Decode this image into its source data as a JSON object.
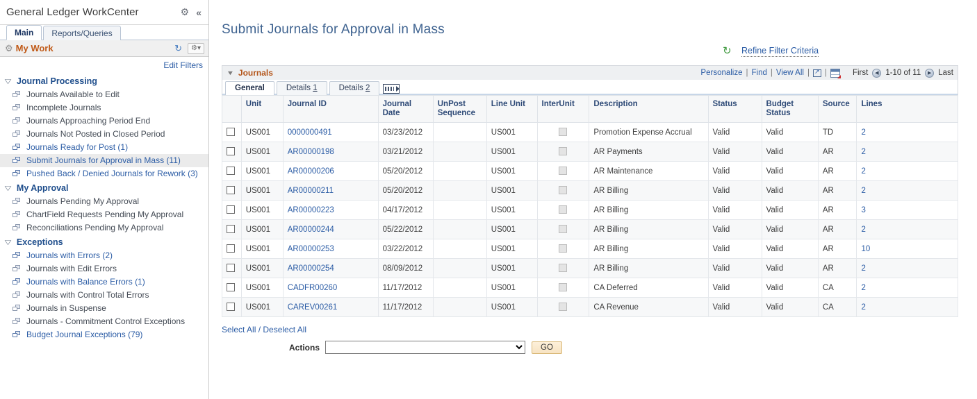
{
  "sidebar": {
    "title": "General Ledger WorkCenter",
    "gear_icon": "gear-icon",
    "collapse_icon": "collapse-icon",
    "tabs": [
      {
        "label": "Main",
        "active": true
      },
      {
        "label": "Reports/Queries",
        "active": false
      }
    ],
    "mywork": {
      "title": "My Work",
      "refresh_icon": "refresh-icon",
      "options_icon": "gear-dropdown-icon"
    },
    "edit_filters": "Edit Filters",
    "groups": [
      {
        "title": "Journal Processing",
        "items": [
          {
            "label": "Journals Available to Edit",
            "link": false,
            "selected": false
          },
          {
            "label": "Incomplete Journals",
            "link": false,
            "selected": false
          },
          {
            "label": "Journals Approaching Period End",
            "link": false,
            "selected": false
          },
          {
            "label": "Journals Not Posted in Closed Period",
            "link": false,
            "selected": false
          },
          {
            "label": "Journals Ready for Post (1)",
            "link": true,
            "selected": false
          },
          {
            "label": "Submit Journals for Approval in Mass (11)",
            "link": true,
            "selected": true
          },
          {
            "label": "Pushed Back / Denied Journals for Rework (3)",
            "link": true,
            "selected": false
          }
        ]
      },
      {
        "title": "My Approval",
        "items": [
          {
            "label": "Journals Pending My Approval",
            "link": false,
            "selected": false
          },
          {
            "label": "ChartField Requests Pending My Approval",
            "link": false,
            "selected": false
          },
          {
            "label": "Reconciliations Pending My Approval",
            "link": false,
            "selected": false
          }
        ]
      },
      {
        "title": "Exceptions",
        "items": [
          {
            "label": "Journals with Errors (2)",
            "link": true,
            "selected": false
          },
          {
            "label": "Journals with Edit Errors",
            "link": false,
            "selected": false
          },
          {
            "label": "Journals with Balance Errors (1)",
            "link": true,
            "selected": false
          },
          {
            "label": "Journals with Control Total Errors",
            "link": false,
            "selected": false
          },
          {
            "label": "Journals in Suspense",
            "link": false,
            "selected": false
          },
          {
            "label": "Journals - Commitment Control Exceptions",
            "link": false,
            "selected": false
          },
          {
            "label": "Budget Journal Exceptions (79)",
            "link": true,
            "selected": false
          }
        ]
      }
    ]
  },
  "main": {
    "page_title": "Submit Journals for Approval in Mass",
    "refine_icon": "refresh-icon",
    "refine_link": "Refine Filter Criteria",
    "grid": {
      "name": "Journals",
      "collapse_icon": "triangle-down-icon",
      "links": {
        "personalize": "Personalize",
        "find": "Find",
        "view_all": "View All"
      },
      "popout_icon": "popout-icon",
      "download_icon": "download-grid-icon",
      "pager": {
        "first": "First",
        "prev_icon": "prev-arrow-icon",
        "range": "1-10 of 11",
        "next_icon": "next-arrow-icon",
        "last": "Last"
      },
      "tabs": [
        {
          "label": "General",
          "accesskey": "",
          "active": true
        },
        {
          "label": "Details ",
          "accesskey": "1",
          "active": false
        },
        {
          "label": "Details ",
          "accesskey": "2",
          "active": false
        }
      ],
      "expand_icon": "expand-tabs-icon",
      "columns": [
        "",
        "Unit",
        "Journal ID",
        "Journal Date",
        "UnPost Sequence",
        "Line Unit",
        "InterUnit",
        "Description",
        "Status",
        "Budget Status",
        "Source",
        "Lines"
      ],
      "rows": [
        {
          "unit": "US001",
          "journal_id": "0000000491",
          "journal_date": "03/23/2012",
          "unpost": "",
          "line_unit": "US001",
          "description": "Promotion Expense Accrual",
          "status": "Valid",
          "budget_status": "Valid",
          "source": "TD",
          "lines": "2"
        },
        {
          "unit": "US001",
          "journal_id": "AR00000198",
          "journal_date": "03/21/2012",
          "unpost": "",
          "line_unit": "US001",
          "description": "AR Payments",
          "status": "Valid",
          "budget_status": "Valid",
          "source": "AR",
          "lines": "2"
        },
        {
          "unit": "US001",
          "journal_id": "AR00000206",
          "journal_date": "05/20/2012",
          "unpost": "",
          "line_unit": "US001",
          "description": "AR Maintenance",
          "status": "Valid",
          "budget_status": "Valid",
          "source": "AR",
          "lines": "2"
        },
        {
          "unit": "US001",
          "journal_id": "AR00000211",
          "journal_date": "05/20/2012",
          "unpost": "",
          "line_unit": "US001",
          "description": "AR Billing",
          "status": "Valid",
          "budget_status": "Valid",
          "source": "AR",
          "lines": "2"
        },
        {
          "unit": "US001",
          "journal_id": "AR00000223",
          "journal_date": "04/17/2012",
          "unpost": "",
          "line_unit": "US001",
          "description": "AR Billing",
          "status": "Valid",
          "budget_status": "Valid",
          "source": "AR",
          "lines": "3"
        },
        {
          "unit": "US001",
          "journal_id": "AR00000244",
          "journal_date": "05/22/2012",
          "unpost": "",
          "line_unit": "US001",
          "description": "AR Billing",
          "status": "Valid",
          "budget_status": "Valid",
          "source": "AR",
          "lines": "2"
        },
        {
          "unit": "US001",
          "journal_id": "AR00000253",
          "journal_date": "03/22/2012",
          "unpost": "",
          "line_unit": "US001",
          "description": "AR Billing",
          "status": "Valid",
          "budget_status": "Valid",
          "source": "AR",
          "lines": "10"
        },
        {
          "unit": "US001",
          "journal_id": "AR00000254",
          "journal_date": "08/09/2012",
          "unpost": "",
          "line_unit": "US001",
          "description": "AR Billing",
          "status": "Valid",
          "budget_status": "Valid",
          "source": "AR",
          "lines": "2"
        },
        {
          "unit": "US001",
          "journal_id": "CADFR00260",
          "journal_date": "11/17/2012",
          "unpost": "",
          "line_unit": "US001",
          "description": "CA Deferred",
          "status": "Valid",
          "budget_status": "Valid",
          "source": "CA",
          "lines": "2"
        },
        {
          "unit": "US001",
          "journal_id": "CAREV00261",
          "journal_date": "11/17/2012",
          "unpost": "",
          "line_unit": "US001",
          "description": "CA Revenue",
          "status": "Valid",
          "budget_status": "Valid",
          "source": "CA",
          "lines": "2"
        }
      ]
    },
    "select_all": "Select All / Deselect All",
    "actions_label": "Actions",
    "actions_value": "",
    "actions_options": [
      ""
    ],
    "go_label": "GO"
  },
  "colors": {
    "link": "#2b5ca5",
    "title": "#3f6390",
    "grid_accent": "#b4561b",
    "mywork_accent": "#c05a18",
    "refresh_green": "#3f9a3f",
    "go_button": "#f7e3c2"
  }
}
